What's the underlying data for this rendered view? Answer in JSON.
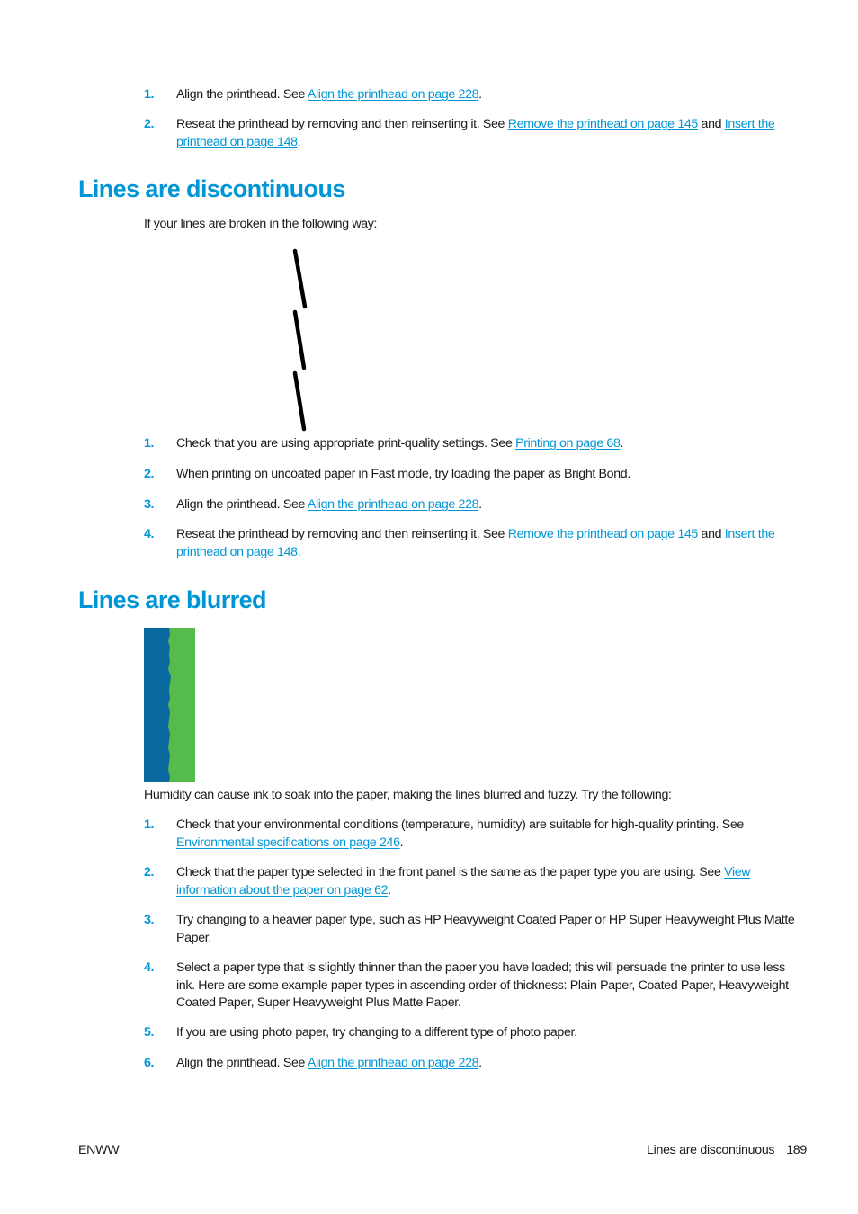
{
  "top_list": [
    {
      "num": "1.",
      "pre": "Align the printhead. See ",
      "link": "Align the printhead on page 228",
      "post": "."
    },
    {
      "num": "2.",
      "pre": "Reseat the printhead by removing and then reinserting it. See ",
      "link": "Remove the printhead on page 145",
      "mid": " and ",
      "link2": "Insert the printhead on page 148",
      "post": "."
    }
  ],
  "section1": {
    "title": "Lines are discontinuous",
    "intro": "If your lines are broken in the following way:",
    "illustration": "broken-line-illustration",
    "steps": [
      {
        "num": "1.",
        "pre": "Check that you are using appropriate print-quality settings. See ",
        "link": "Printing on page 68",
        "post": "."
      },
      {
        "num": "2.",
        "pre": "When printing on uncoated paper in Fast mode, try loading the paper as Bright Bond."
      },
      {
        "num": "3.",
        "pre": "Align the printhead. See ",
        "link": "Align the printhead on page 228",
        "post": "."
      },
      {
        "num": "4.",
        "pre": "Reseat the printhead by removing and then reinserting it. See ",
        "link": "Remove the printhead on page 145",
        "mid": " and ",
        "link2": "Insert the printhead on page 148",
        "post": "."
      }
    ]
  },
  "section2": {
    "title": "Lines are blurred",
    "illustration": "blurred-line-illustration",
    "colors": {
      "blue": "#0a6aa0",
      "green": "#55bb4a"
    },
    "intro": "Humidity can cause ink to soak into the paper, making the lines blurred and fuzzy. Try the following:",
    "steps": [
      {
        "num": "1.",
        "pre": "Check that your environmental conditions (temperature, humidity) are suitable for high-quality printing. See ",
        "link": "Environmental specifications on page 246",
        "post": "."
      },
      {
        "num": "2.",
        "pre": "Check that the paper type selected in the front panel is the same as the paper type you are using. See ",
        "link": "View information about the paper on page 62",
        "post": "."
      },
      {
        "num": "3.",
        "pre": "Try changing to a heavier paper type, such as HP Heavyweight Coated Paper or HP Super Heavyweight Plus Matte Paper."
      },
      {
        "num": "4.",
        "pre": "Select a paper type that is slightly thinner than the paper you have loaded; this will persuade the printer to use less ink. Here are some example paper types in ascending order of thickness: Plain Paper, Coated Paper, Heavyweight Coated Paper, Super Heavyweight Plus Matte Paper."
      },
      {
        "num": "5.",
        "pre": "If you are using photo paper, try changing to a different type of photo paper."
      },
      {
        "num": "6.",
        "pre": "Align the printhead. See ",
        "link": "Align the printhead on page 228",
        "post": "."
      }
    ]
  },
  "footer": {
    "left": "ENWW",
    "section": "Lines are discontinuous",
    "page": "189"
  },
  "accent_color": "#0096d6"
}
